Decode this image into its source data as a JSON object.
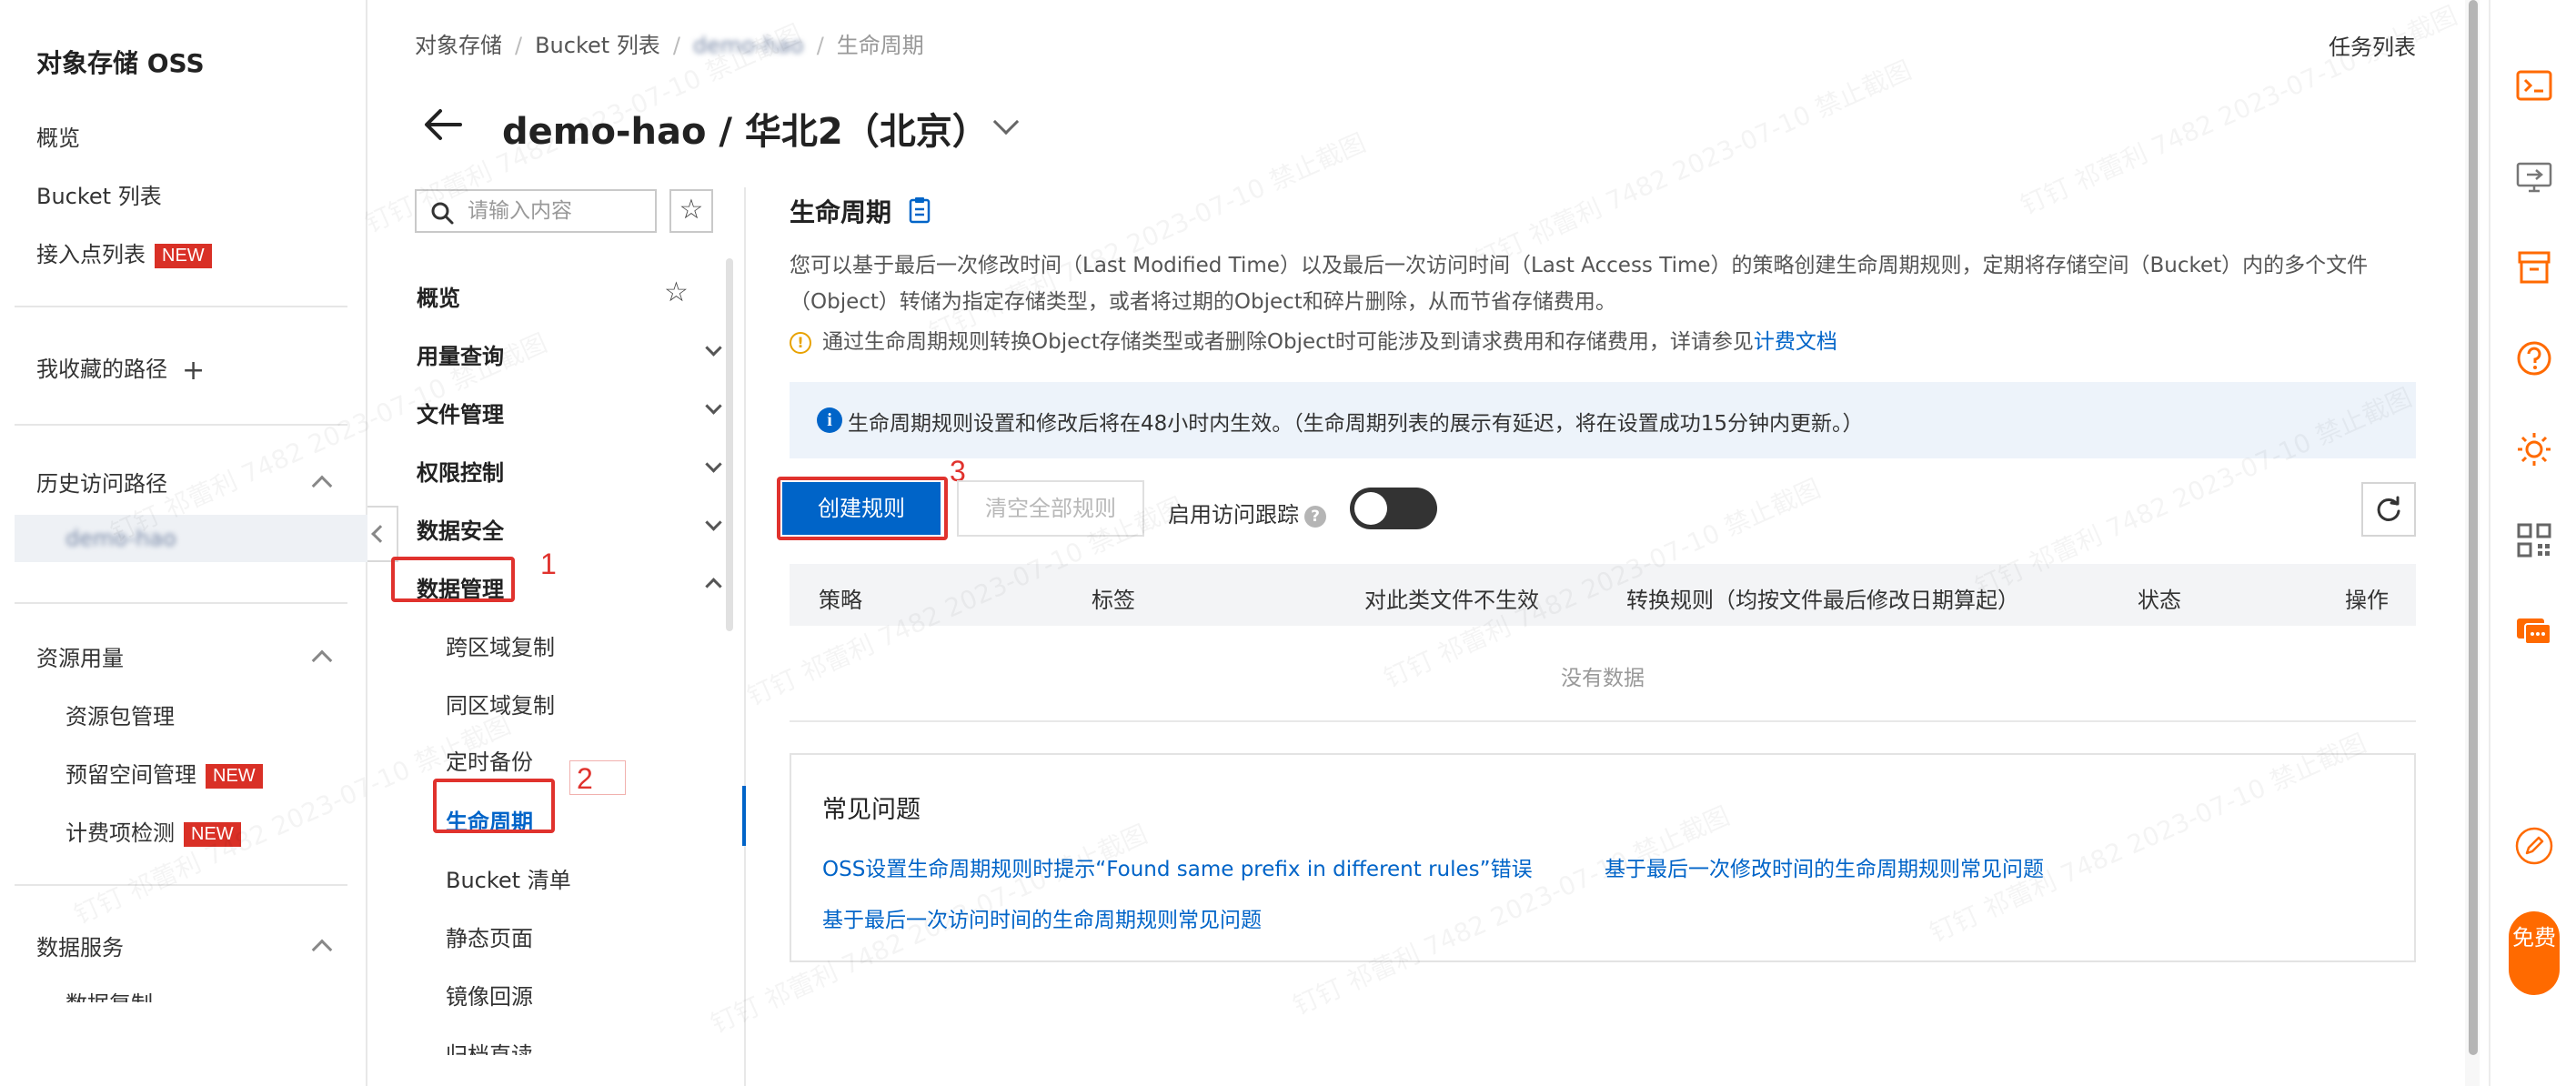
{
  "sidebar": {
    "title": "对象存储 OSS",
    "overview": "概览",
    "bucket_list": "Bucket 列表",
    "access_points": "接入点列表",
    "new_badge": "NEW",
    "favorites": "我收藏的路径",
    "history": "历史访问路径",
    "history_item": "demo-hao",
    "resources": "资源用量",
    "resource_pack": "资源包管理",
    "reserved_space": "预留空间管理",
    "billing_check": "计费项检测",
    "data_service": "数据服务",
    "data_service_sub": "数据复制"
  },
  "breadcrumb": {
    "items": [
      "对象存储",
      "Bucket 列表",
      "demo-hao",
      "生命周期"
    ]
  },
  "task_list": "任务列表",
  "page_title": "demo-hao / 华北2（北京）",
  "search": {
    "placeholder": "请输入内容",
    "value": ""
  },
  "nav": {
    "overview": "概览",
    "usage": "用量查询",
    "files": "文件管理",
    "permissions": "权限控制",
    "security": "数据安全",
    "data_mgmt": "数据管理",
    "sub": [
      "跨区域复制",
      "同区域复制",
      "定时备份",
      "生命周期",
      "Bucket 清单",
      "静态页面",
      "镜像回源",
      "归档直读"
    ]
  },
  "annotations": [
    "1",
    "2",
    "3"
  ],
  "section": {
    "title": "生命周期",
    "desc_line1": "您可以基于最后一次修改时间（Last Modified Time）以及最后一次访问时间（Last Access Time）的策略创建生命周期规则，定期将存储空间（Bucket）内的多个文件",
    "desc_line2": "（Object）转储为指定存储类型，或者将过期的Object和碎片删除，从而节省存储费用。",
    "warn_text": "通过生命周期规则转换Object存储类型或者删除Object时可能涉及到请求费用和存储费用，详请参见",
    "warn_link": "计费文档",
    "info_text": "生命周期规则设置和修改后将在48小时内生效。（生命周期列表的展示有延迟，将在设置成功15分钟内更新。）"
  },
  "toolbar": {
    "create": "创建规则",
    "clear_all": "清空全部规则",
    "access_tracking": "启用访问跟踪",
    "access_tracking_on": false
  },
  "table": {
    "headers": [
      "策略",
      "标签",
      "对此类文件不生效",
      "转换规则（均按文件最后修改日期算起）",
      "状态",
      "操作"
    ],
    "empty": "没有数据"
  },
  "faq": {
    "title": "常见问题",
    "links": [
      "OSS设置生命周期规则时提示“Found same prefix in different rules”错误",
      "基于最后一次修改时间的生命周期规则常见问题",
      "基于最后一次访问时间的生命周期规则常见问题"
    ]
  },
  "right_toolbar": {
    "icons": [
      "expand-icon",
      "terminal-icon",
      "monitor-icon",
      "archive-icon",
      "help-icon",
      "sun-icon",
      "qrcode-icon",
      "chat-icon",
      "edit-icon"
    ],
    "free_label": "免费"
  },
  "watermark": "钉钉 祁蕾利 7482 2023-07-10 禁止截图",
  "colors": {
    "accent": "#0064c8",
    "annotation": "#e0322d",
    "badge": "#d93026",
    "free": "#ff6a00"
  }
}
